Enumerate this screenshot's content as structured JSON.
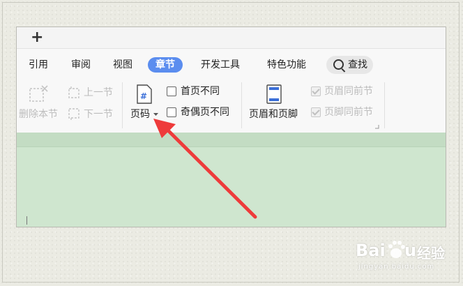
{
  "tabbar": {
    "new_tab": "+"
  },
  "menu": {
    "items": [
      "引用",
      "审阅",
      "视图",
      "章节",
      "开发工具",
      "特色功能"
    ],
    "active": "章节",
    "search_label": "查找"
  },
  "ribbon": {
    "delete_section": "删除本节",
    "prev_section": "上一节",
    "next_section": "下一节",
    "page_number": "页码",
    "first_page_different": "首页不同",
    "odd_even_different": "奇偶页不同",
    "header_footer": "页眉和页脚",
    "header_same_as_previous": "页眉同前节",
    "footer_same_as_previous": "页脚同前节"
  },
  "colors": {
    "active_tab": "#5b8def",
    "arrow": "#ee3b3b",
    "document_bg": "#cfe6cf"
  }
}
